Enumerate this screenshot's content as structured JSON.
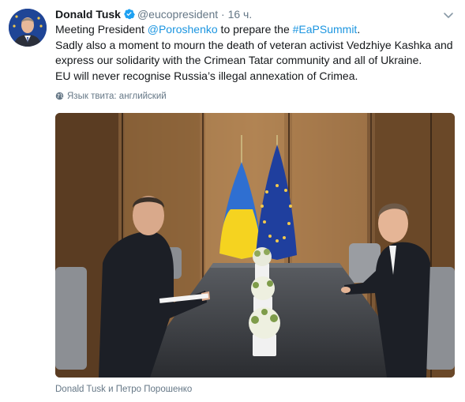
{
  "tweet": {
    "author_name": "Donald Tusk",
    "handle": "@eucopresident",
    "separator": "·",
    "time": "16 ч.",
    "text_lines": [
      {
        "prefix": "Meeting President ",
        "mention": "@Poroshenko",
        "middle": " to prepare the ",
        "hashtag": "#EaPSummit",
        "suffix": "."
      },
      {
        "text": "Sadly also a moment to mourn the death of veteran activist Vedzhiye Kashka and"
      },
      {
        "text": "express our solidarity with the Crimean Tatar community and all of Ukraine."
      },
      {
        "text": "EU will never recognise Russia’s illegal annexation of Crimea."
      }
    ],
    "language_label": "Язык твита: английский",
    "photo_caption": "Donald Tusk и Петро Порошенко"
  },
  "colors": {
    "link": "#1b95e0",
    "secondary_text": "#657786",
    "verified": "#1da1f2"
  },
  "icons": {
    "verified": "verified-badge-icon",
    "caret": "chevron-down-icon",
    "globe": "globe-icon"
  }
}
